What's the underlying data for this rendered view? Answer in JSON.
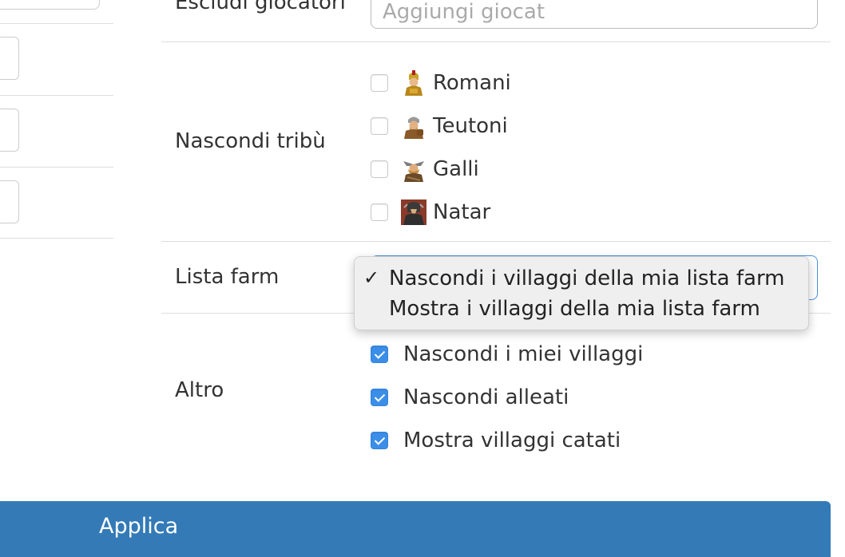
{
  "exclude_players": {
    "label": "Escludi giocatori",
    "placeholder": "Aggiungi giocat"
  },
  "hide_tribes": {
    "label": "Nascondi tribù",
    "options": [
      {
        "label": "Romani",
        "icon": "romans-tribe-icon",
        "checked": false
      },
      {
        "label": "Teutoni",
        "icon": "teutons-tribe-icon",
        "checked": false
      },
      {
        "label": "Galli",
        "icon": "gauls-tribe-icon",
        "checked": false
      },
      {
        "label": "Natar",
        "icon": "natars-tribe-icon",
        "checked": false
      }
    ]
  },
  "farm_list": {
    "label": "Lista farm",
    "selected": "Nascondi i villaggi della mia lista farm",
    "options": [
      "Nascondi i villaggi della mia lista farm",
      "Mostra i villaggi della mia lista farm"
    ],
    "tick": "✓"
  },
  "other": {
    "label": "Altro",
    "options": [
      {
        "label": "Nascondi i miei villaggi",
        "checked": true
      },
      {
        "label": "Nascondi alleati",
        "checked": true
      },
      {
        "label": "Mostra villaggi catati",
        "checked": true
      }
    ]
  },
  "apply_button": {
    "label": "Applica"
  },
  "colors": {
    "accent_checkbox": "#3b8ee8",
    "apply_button": "#337ab7",
    "separator": "#dddddd"
  }
}
